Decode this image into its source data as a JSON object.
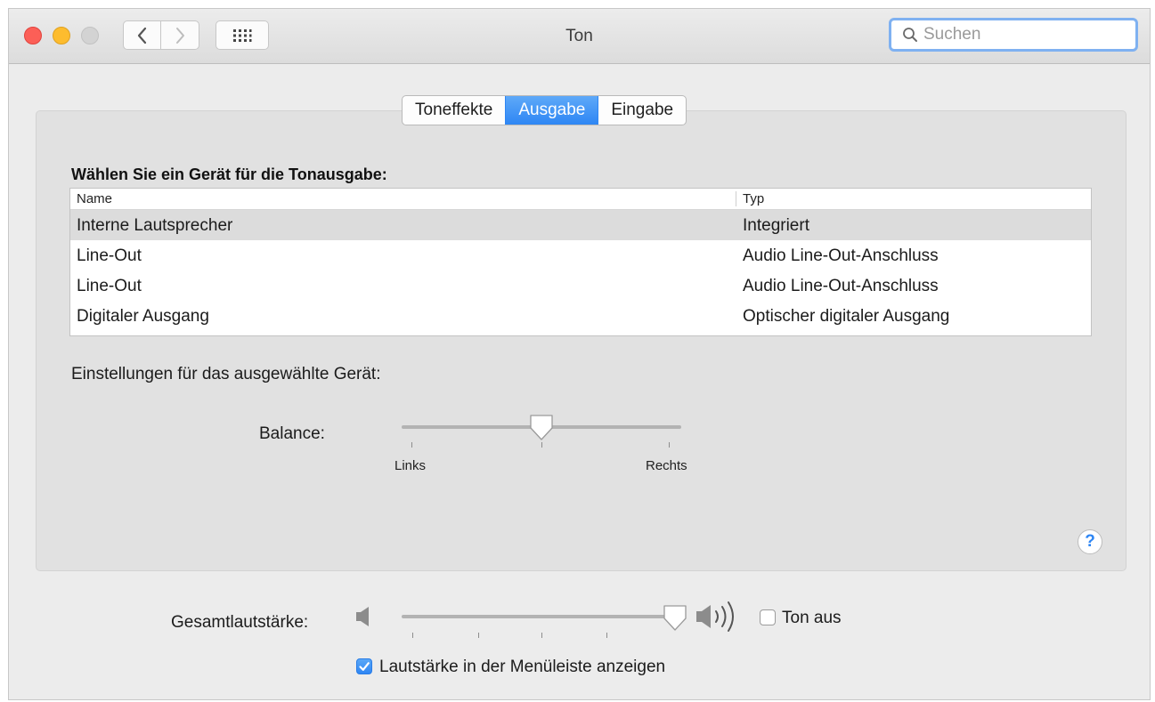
{
  "window": {
    "title": "Ton"
  },
  "search": {
    "placeholder": "Suchen"
  },
  "tabs": [
    {
      "label": "Toneffekte",
      "active": false
    },
    {
      "label": "Ausgabe",
      "active": true
    },
    {
      "label": "Eingabe",
      "active": false
    }
  ],
  "output": {
    "heading": "Wählen Sie ein Gerät für die Tonausgabe:",
    "columns": [
      "Name",
      "Typ"
    ],
    "rows": [
      {
        "name": "Interne Lautsprecher",
        "type": "Integriert",
        "selected": true
      },
      {
        "name": "Line-Out",
        "type": "Audio Line-Out-Anschluss",
        "selected": false
      },
      {
        "name": "Line-Out",
        "type": "Audio Line-Out-Anschluss",
        "selected": false
      },
      {
        "name": "Digitaler Ausgang",
        "type": "Optischer digitaler Ausgang",
        "selected": false
      }
    ],
    "settings_label": "Einstellungen für das ausgewählte Gerät:",
    "balance": {
      "label": "Balance:",
      "left_label": "Links",
      "right_label": "Rechts",
      "value": 0.5
    }
  },
  "footer": {
    "volume": {
      "label": "Gesamtlautstärke:",
      "value": 0.99
    },
    "mute": {
      "label": "Ton aus",
      "checked": false
    },
    "show_in_menubar": {
      "label": "Lautstärke in der Menüleiste anzeigen",
      "checked": true
    }
  },
  "colors": {
    "accent": "#2e86f4",
    "close": "#fc5f57",
    "minimize": "#fdbc2e",
    "zoom": "#d3d3d3"
  },
  "icons": [
    "chevron-left-icon",
    "chevron-right-icon",
    "grid-icon",
    "search-icon",
    "speaker-low-icon",
    "speaker-high-icon",
    "checkmark-icon",
    "help-icon"
  ]
}
